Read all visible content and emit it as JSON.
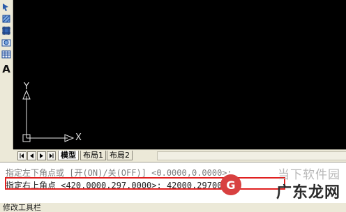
{
  "draw_toolbar": {
    "items": [
      {
        "icon": "select-icon"
      },
      {
        "icon": "hatch-icon"
      },
      {
        "icon": "gradient-icon"
      },
      {
        "icon": "region-icon"
      },
      {
        "icon": "table-icon"
      },
      {
        "icon": "text-icon",
        "glyph": "A"
      }
    ]
  },
  "canvas": {
    "background": "#000000",
    "ucs": {
      "y_label": "Y",
      "x_label": "X"
    }
  },
  "layout_tabs": {
    "tabs": [
      {
        "label": "模型",
        "active": true
      },
      {
        "label": "布局1",
        "active": false
      },
      {
        "label": "布局2",
        "active": false
      }
    ]
  },
  "command_line": {
    "previous_prompt": "指定左下角点或 [开(ON)/关(OFF)] <0.0000,0.0000>:",
    "current_prompt": "指定右上角点 <420.0000,297.0000>: 42000,29700",
    "highlight_color": "#e02020"
  },
  "status_bar": {
    "label": "修改工具栏"
  },
  "watermark": {
    "top_text": "当下软件园",
    "main_text": "广东龙网",
    "logo_glyph": "G"
  }
}
